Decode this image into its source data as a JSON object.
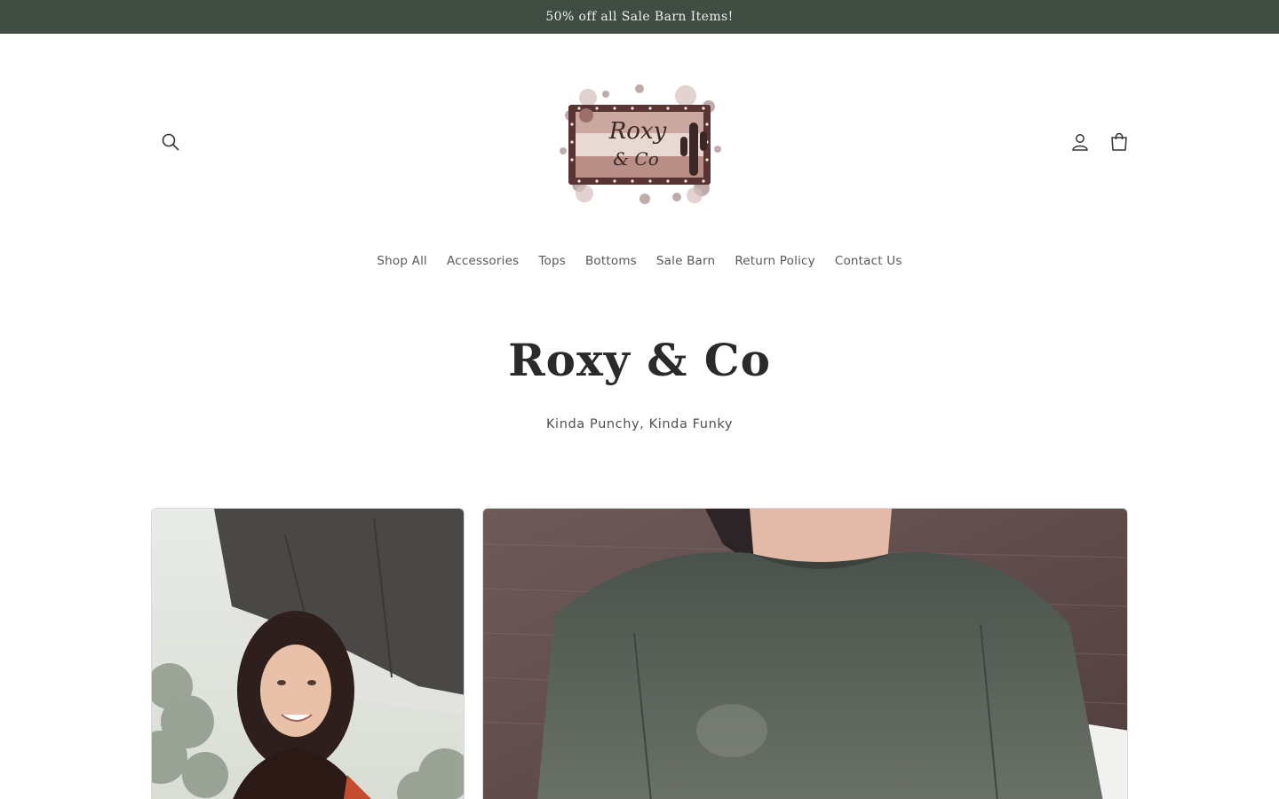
{
  "announcement": {
    "text": "50% off all Sale Barn Items!"
  },
  "header": {
    "search_icon": "search-icon",
    "account_icon": "account-icon",
    "cart_icon": "cart-icon",
    "logo": {
      "line1": "Roxy",
      "line2": "& Co"
    }
  },
  "nav": {
    "items": [
      {
        "label": "Shop All"
      },
      {
        "label": "Accessories"
      },
      {
        "label": "Tops"
      },
      {
        "label": "Bottoms"
      },
      {
        "label": "Sale Barn"
      },
      {
        "label": "Return Policy"
      },
      {
        "label": "Contact Us"
      }
    ]
  },
  "hero": {
    "title": "Roxy & Co",
    "subtitle": "Kinda Punchy, Kinda Funky"
  },
  "colors": {
    "announcement_bg": "#3f4d43",
    "announcement_text": "#eef0ea",
    "nav_text": "#555a56"
  }
}
